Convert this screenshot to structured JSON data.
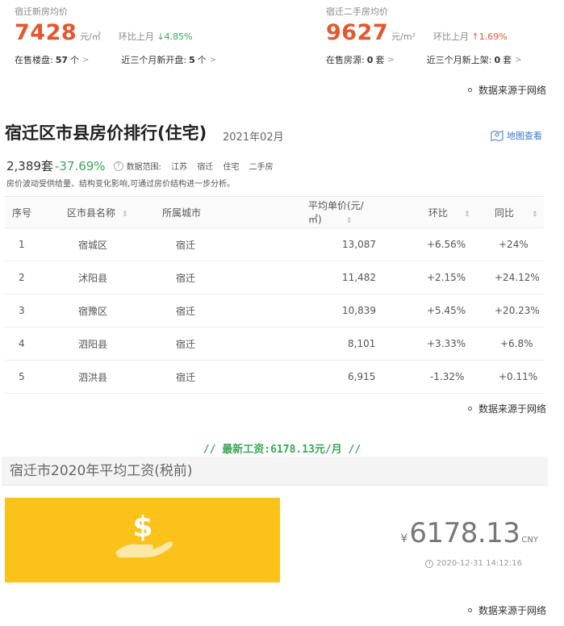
{
  "new_house": {
    "title": "宿迁新房均价",
    "price": "7428",
    "unit": "元/㎡",
    "mom_label": "环比上月",
    "mom_value": "↓4.85%",
    "on_sale_label": "在售楼盘:",
    "on_sale_count": "57",
    "on_sale_unit": "个",
    "recent_label": "近三个月新开盘:",
    "recent_count": "5",
    "recent_unit": "个"
  },
  "second_house": {
    "title": "宿迁二手房均价",
    "price": "9627",
    "unit": "元/m²",
    "mom_label": "环比上月",
    "mom_value": "↑1.69%",
    "on_sale_label": "在售房源:",
    "on_sale_count": "0",
    "on_sale_unit": "套",
    "recent_label": "近三个月新上架:",
    "recent_count": "0",
    "recent_unit": "套"
  },
  "source_label": "数据来源于网络",
  "ranking": {
    "title": "宿迁区市县房价排行(住宅)",
    "date": "2021年02月",
    "map_link": "地图查看",
    "count": "2,389套",
    "change": "-37.69%",
    "scope_label": "数据范围:",
    "scope": [
      "江苏",
      "宿迁",
      "住宅",
      "二手房"
    ],
    "note": "房价波动受供给量、结构变化影响,可通过房价结构进一步分析。",
    "columns": [
      "序号",
      "区市县名称",
      "所属城市",
      "平均单价(元/㎡)",
      "环比",
      "同比"
    ],
    "rows": [
      {
        "no": "1",
        "name": "宿城区",
        "city": "宿迁",
        "price": "13,087",
        "mom": "+6.56%",
        "yoy": "+24%"
      },
      {
        "no": "2",
        "name": "沭阳县",
        "city": "宿迁",
        "price": "11,482",
        "mom": "+2.15%",
        "yoy": "+24.12%"
      },
      {
        "no": "3",
        "name": "宿豫区",
        "city": "宿迁",
        "price": "10,839",
        "mom": "+5.45%",
        "yoy": "+20.23%"
      },
      {
        "no": "4",
        "name": "泗阳县",
        "city": "宿迁",
        "price": "8,101",
        "mom": "+3.33%",
        "yoy": "+6.8%"
      },
      {
        "no": "5",
        "name": "泗洪县",
        "city": "宿迁",
        "price": "6,915",
        "mom": "-1.32%",
        "yoy": "+0.11%"
      }
    ]
  },
  "salary": {
    "headline": "// 最新工资:6178.13元/月 //",
    "title": "宿迁市2020年平均工资(税前)",
    "currency_symbol": "¥",
    "amount": "6178.13",
    "currency_code": "CNY",
    "timestamp": "2020-12-31 14:12:16"
  },
  "colors": {
    "price_red": "#e4572e",
    "down_green": "#3aa757",
    "positive": "#c8223a",
    "negative": "#2d9b4a",
    "salary_yellow": "#fbc21a",
    "link_blue": "#3a7bd5"
  },
  "icons": [
    "sort-icon",
    "help-icon",
    "map-pin-icon",
    "dollar-hand-icon",
    "clock-icon",
    "source-dot-icon",
    "chevron-right-icon"
  ]
}
